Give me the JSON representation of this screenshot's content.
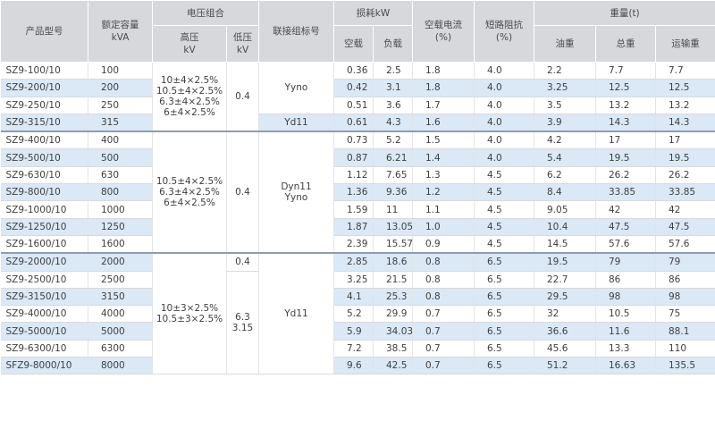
{
  "headers": {
    "model": "产品型号",
    "capacity": [
      "额定容量",
      "kVA"
    ],
    "voltage_group": "电压组合",
    "hv": [
      "高压",
      "kV"
    ],
    "lv": [
      "低压",
      "kV"
    ],
    "connection": "联接组标号",
    "loss": "损耗kW",
    "no_load": "空载",
    "load": "负载",
    "no_load_current": [
      "空载电流",
      "(%)"
    ],
    "impedance": [
      "短路阻抗",
      "(%)"
    ],
    "weight": "重量(t)",
    "oil": "油重",
    "total": "总重",
    "transport": "运输重"
  },
  "groups": [
    {
      "hv": [
        "10±4×2.5%",
        "10.5±4×2.5%",
        "6.3±4×2.5%",
        "6±4×2.5%"
      ],
      "lv": [
        "0.4"
      ]
    },
    {
      "hv": [
        "10.5±4×2.5%",
        "6.3±4×2.5%",
        "6±4×2.5%"
      ],
      "lv": [
        "0.4"
      ],
      "connection": [
        "Dyn11",
        "Yyno"
      ]
    },
    {
      "hv": [
        "10±3×2.5%",
        "10.5±3×2.5%"
      ],
      "lv_first": "0.4",
      "lv": [
        "6.3",
        "3.15"
      ],
      "connection": [
        "Yd11"
      ]
    }
  ],
  "conn_g1": {
    "a": "Yyno",
    "b": "Yd11"
  },
  "rows": [
    {
      "model": "SZ9-100/10",
      "cap": "100",
      "p0": "0.36",
      "pk": "2.5",
      "i0": "1.8",
      "uk": "4.0",
      "oil": "2.2",
      "total": "7.7",
      "trans": "7.7"
    },
    {
      "model": "SZ9-200/10",
      "cap": "200",
      "p0": "0.42",
      "pk": "3.1",
      "i0": "1.8",
      "uk": "4.0",
      "oil": "3.25",
      "total": "12.5",
      "trans": "12.5"
    },
    {
      "model": "SZ9-250/10",
      "cap": "250",
      "p0": "0.51",
      "pk": "3.6",
      "i0": "1.7",
      "uk": "4.0",
      "oil": "3.5",
      "total": "13.2",
      "trans": "13.2"
    },
    {
      "model": "SZ9-315/10",
      "cap": "315",
      "p0": "0.61",
      "pk": "4.3",
      "i0": "1.6",
      "uk": "4.0",
      "oil": "3.9",
      "total": "14.3",
      "trans": "14.3"
    },
    {
      "model": "SZ9-400/10",
      "cap": "400",
      "p0": "0.73",
      "pk": "5.2",
      "i0": "1.5",
      "uk": "4.0",
      "oil": "4.2",
      "total": "17",
      "trans": "17"
    },
    {
      "model": "SZ9-500/10",
      "cap": "500",
      "p0": "0.87",
      "pk": "6.21",
      "i0": "1.4",
      "uk": "4.0",
      "oil": "5.4",
      "total": "19.5",
      "trans": "19.5"
    },
    {
      "model": "SZ9-630/10",
      "cap": "630",
      "p0": "1.12",
      "pk": "7.65",
      "i0": "1.3",
      "uk": "4.5",
      "oil": "6.2",
      "total": "26.2",
      "trans": "26.2"
    },
    {
      "model": "SZ9-800/10",
      "cap": "800",
      "p0": "1.36",
      "pk": "9.36",
      "i0": "1.2",
      "uk": "4.5",
      "oil": "8.4",
      "total": "33.85",
      "trans": "33.85"
    },
    {
      "model": "SZ9-1000/10",
      "cap": "1000",
      "p0": "1.59",
      "pk": "11",
      "i0": "1.1",
      "uk": "4.5",
      "oil": "9.05",
      "total": "42",
      "trans": "42"
    },
    {
      "model": "SZ9-1250/10",
      "cap": "1250",
      "p0": "1.87",
      "pk": "13.05",
      "i0": "1.0",
      "uk": "4.5",
      "oil": "10.4",
      "total": "47.5",
      "trans": "47.5"
    },
    {
      "model": "SZ9-1600/10",
      "cap": "1600",
      "p0": "2.39",
      "pk": "15.57",
      "i0": "0.9",
      "uk": "4.5",
      "oil": "14.5",
      "total": "57.6",
      "trans": "57.6"
    },
    {
      "model": "SZ9-2000/10",
      "cap": "2000",
      "p0": "2.85",
      "pk": "18.6",
      "i0": "0.8",
      "uk": "6.5",
      "oil": "19.5",
      "total": "79",
      "trans": "79"
    },
    {
      "model": "SZ9-2500/10",
      "cap": "2500",
      "p0": "3.25",
      "pk": "21.5",
      "i0": "0.8",
      "uk": "6.5",
      "oil": "22.7",
      "total": "86",
      "trans": "86"
    },
    {
      "model": "SZ9-3150/10",
      "cap": "3150",
      "p0": "4.1",
      "pk": "25.3",
      "i0": "0.8",
      "uk": "6.5",
      "oil": "29.5",
      "total": "98",
      "trans": "98"
    },
    {
      "model": "SZ9-4000/10",
      "cap": "4000",
      "p0": "5.2",
      "pk": "29.9",
      "i0": "0.7",
      "uk": "6.5",
      "oil": "32",
      "total": "10.5",
      "trans": "75"
    },
    {
      "model": "SZ9-5000/10",
      "cap": "5000",
      "p0": "5.9",
      "pk": "34.03",
      "i0": "0.7",
      "uk": "6.5",
      "oil": "36.6",
      "total": "11.6",
      "trans": "88.1"
    },
    {
      "model": "SZ9-6300/10",
      "cap": "6300",
      "p0": "7.2",
      "pk": "38.5",
      "i0": "0.7",
      "uk": "6.5",
      "oil": "45.6",
      "total": "13.3",
      "trans": "110"
    },
    {
      "model": "SFZ9-8000/10",
      "cap": "8000",
      "p0": "9.6",
      "pk": "42.5",
      "i0": "0.7",
      "uk": "6.5",
      "oil": "51.2",
      "total": "16.63",
      "trans": "135.5"
    }
  ]
}
